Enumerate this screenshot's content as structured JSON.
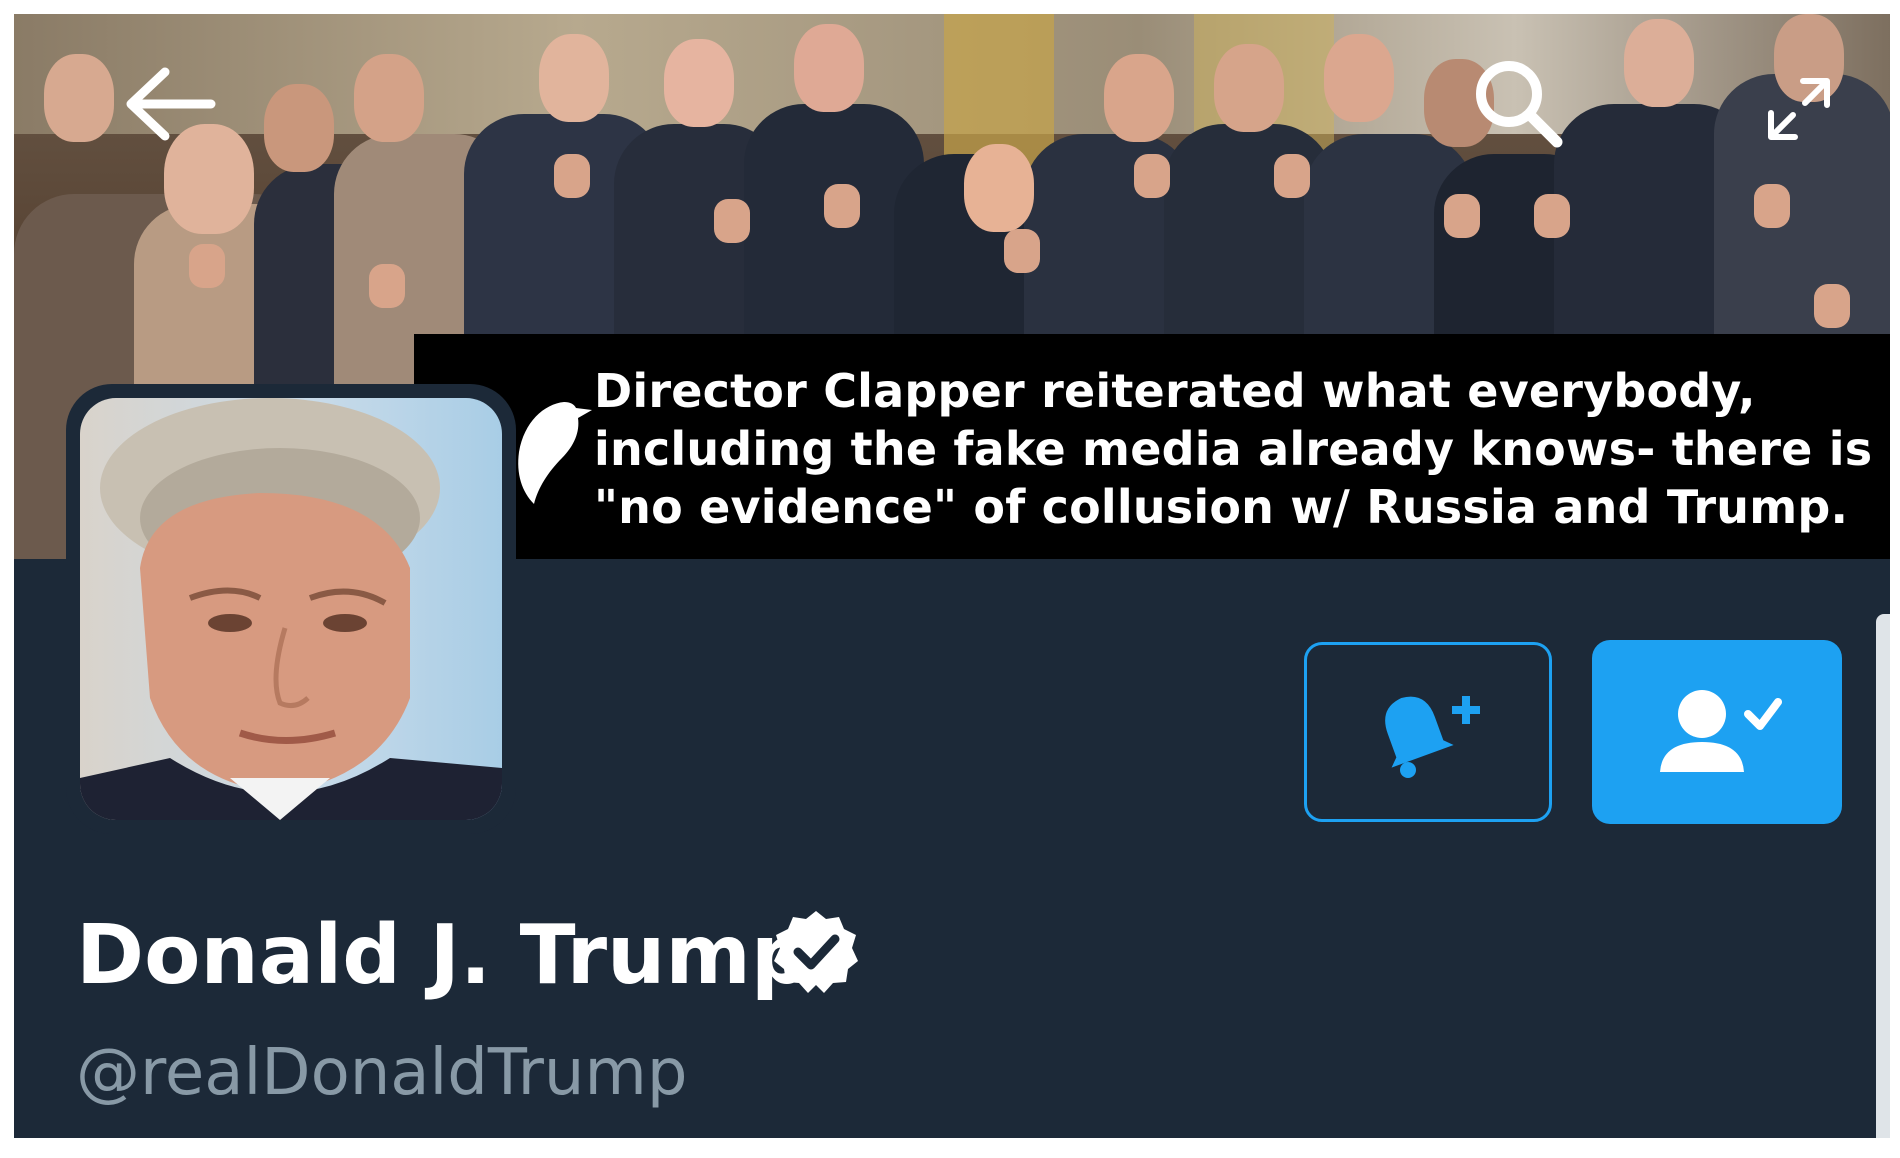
{
  "banner": {
    "description_icon": "crowd-photo"
  },
  "toolbar": {
    "back_icon": "back-arrow-icon",
    "search_icon": "search-icon",
    "expand_icon": "expand-icon"
  },
  "tweet": {
    "text": "Director Clapper reiterated what everybody,\nincluding the fake media already knows- there is\n\"no evidence\" of collusion w/ Russia and Trump."
  },
  "profile": {
    "display_name": "Donald J. Trump",
    "handle": "@realDonaldTrump",
    "verified": true
  },
  "actions": {
    "notify_icon": "bell-plus-icon",
    "following_icon": "user-check-icon"
  },
  "colors": {
    "background": "#1c2938",
    "accent": "#1da1f2",
    "handle_text": "#8899a6",
    "tweet_box": "#000000"
  }
}
